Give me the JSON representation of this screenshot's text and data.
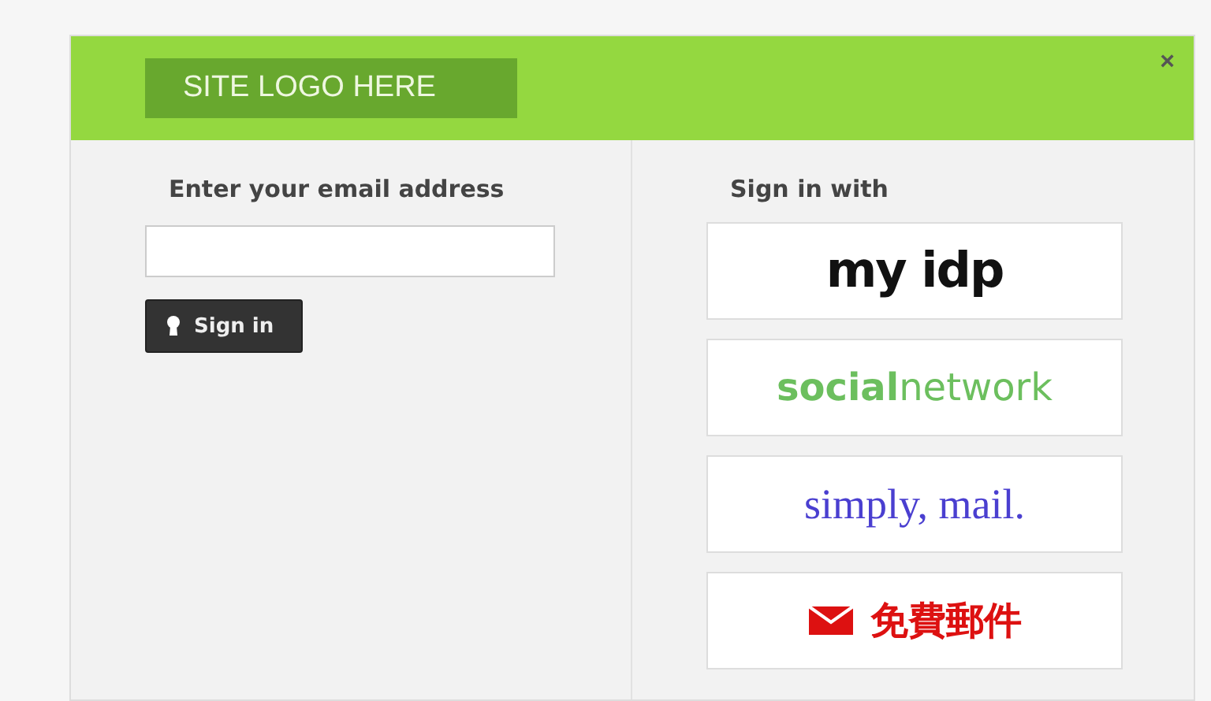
{
  "header": {
    "logo": "SITE LOGO HERE",
    "close": "×"
  },
  "email_form": {
    "label": "Enter your email address",
    "button": "Sign in"
  },
  "providers": {
    "heading": "Sign in with",
    "items": [
      {
        "kind": "bold",
        "label": "my idp"
      },
      {
        "kind": "social",
        "label": "**social**network"
      },
      {
        "kind": "serif",
        "label": "simply, mail."
      },
      {
        "kind": "envelope",
        "label": "免費郵件"
      }
    ]
  }
}
